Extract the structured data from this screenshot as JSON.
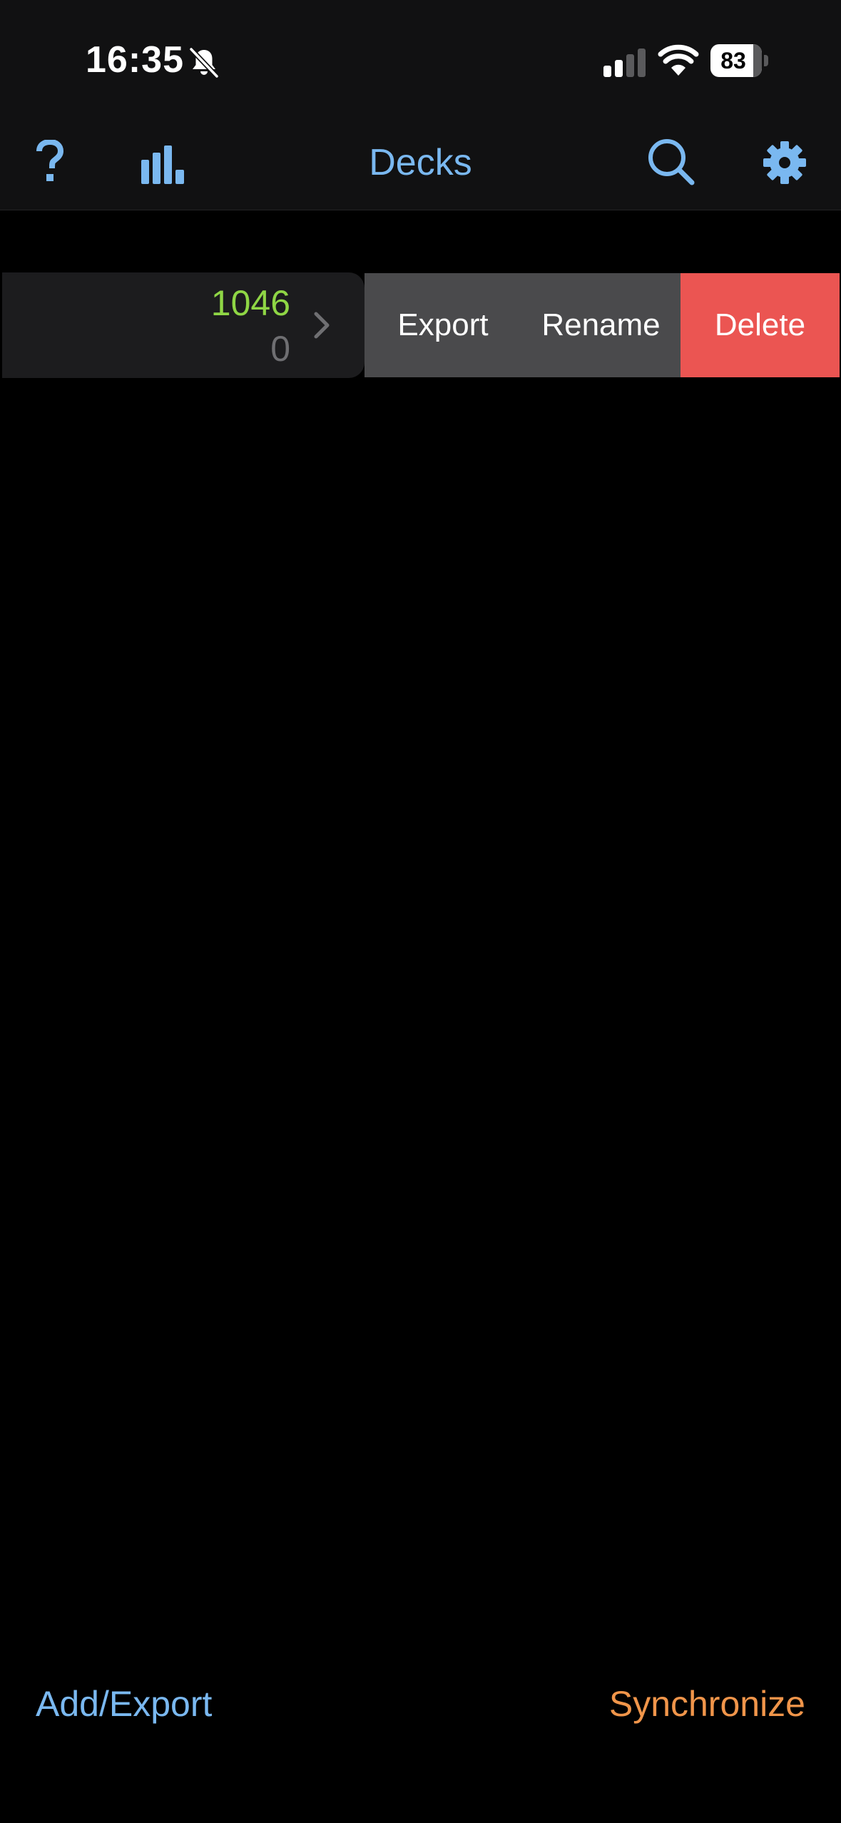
{
  "status_bar": {
    "time": "16:35",
    "battery": "83",
    "icons": [
      "bell-slash-icon",
      "cellular-signal-icon",
      "wifi-icon",
      "battery-icon"
    ]
  },
  "nav": {
    "title": "Decks",
    "icons": [
      "help-icon",
      "statistics-icon",
      "search-icon",
      "settings-icon"
    ],
    "accent_color": "#7ab8f0"
  },
  "deck_row": {
    "due_count": "1046",
    "new_count": "0",
    "due_color": "#8fd645",
    "icon": "chevron-right-icon"
  },
  "swipe_actions": {
    "export": "Export",
    "rename": "Rename",
    "delete": "Delete",
    "delete_color": "#eb5552",
    "neutral_color": "#4a4a4c"
  },
  "bottom_bar": {
    "add_export": "Add/Export",
    "synchronize": "Synchronize",
    "synchronize_color": "#f0954a"
  }
}
